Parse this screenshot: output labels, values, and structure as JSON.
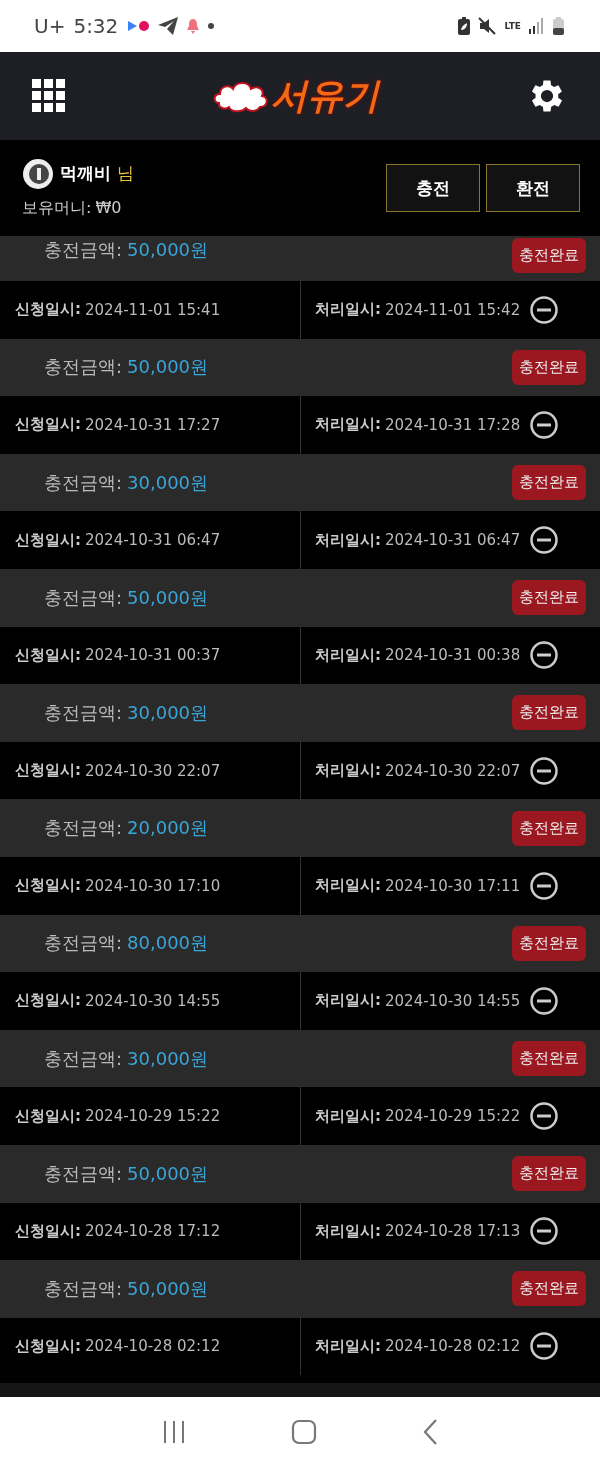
{
  "status_bar": {
    "carrier": "U+",
    "time": "5:32",
    "network": "LTE"
  },
  "header": {
    "logo_text": "서유기"
  },
  "user": {
    "name": "먹깨비",
    "suffix": "님",
    "balance_label": "보유머니:",
    "balance": "₩0"
  },
  "actions": [
    "충전",
    "환전"
  ],
  "records": [
    {
      "amount_label": "충전금액:",
      "amount": "50,000원",
      "status": "충전완료",
      "requested_label": "신청일시:",
      "requested_at": "2024-11-01 15:41",
      "processed_label": "처리일시:",
      "processed_at": "2024-11-01 15:42"
    },
    {
      "amount_label": "충전금액:",
      "amount": "50,000원",
      "status": "충전완료",
      "requested_label": "신청일시:",
      "requested_at": "2024-10-31 17:27",
      "processed_label": "처리일시:",
      "processed_at": "2024-10-31 17:28"
    },
    {
      "amount_label": "충전금액:",
      "amount": "30,000원",
      "status": "충전완료",
      "requested_label": "신청일시:",
      "requested_at": "2024-10-31 06:47",
      "processed_label": "처리일시:",
      "processed_at": "2024-10-31 06:47"
    },
    {
      "amount_label": "충전금액:",
      "amount": "50,000원",
      "status": "충전완료",
      "requested_label": "신청일시:",
      "requested_at": "2024-10-31 00:37",
      "processed_label": "처리일시:",
      "processed_at": "2024-10-31 00:38"
    },
    {
      "amount_label": "충전금액:",
      "amount": "30,000원",
      "status": "충전완료",
      "requested_label": "신청일시:",
      "requested_at": "2024-10-30 22:07",
      "processed_label": "처리일시:",
      "processed_at": "2024-10-30 22:07"
    },
    {
      "amount_label": "충전금액:",
      "amount": "20,000원",
      "status": "충전완료",
      "requested_label": "신청일시:",
      "requested_at": "2024-10-30 17:10",
      "processed_label": "처리일시:",
      "processed_at": "2024-10-30 17:11"
    },
    {
      "amount_label": "충전금액:",
      "amount": "80,000원",
      "status": "충전완료",
      "requested_label": "신청일시:",
      "requested_at": "2024-10-30 14:55",
      "processed_label": "처리일시:",
      "processed_at": "2024-10-30 14:55"
    },
    {
      "amount_label": "충전금액:",
      "amount": "30,000원",
      "status": "충전완료",
      "requested_label": "신청일시:",
      "requested_at": "2024-10-29 15:22",
      "processed_label": "처리일시:",
      "processed_at": "2024-10-29 15:22"
    },
    {
      "amount_label": "충전금액:",
      "amount": "50,000원",
      "status": "충전완료",
      "requested_label": "신청일시:",
      "requested_at": "2024-10-28 17:12",
      "processed_label": "처리일시:",
      "processed_at": "2024-10-28 17:13"
    },
    {
      "amount_label": "충전금액:",
      "amount": "50,000원",
      "status": "충전완료",
      "requested_label": "신청일시:",
      "requested_at": "2024-10-28 02:12",
      "processed_label": "처리일시:",
      "processed_at": "2024-10-28 02:12"
    }
  ]
}
